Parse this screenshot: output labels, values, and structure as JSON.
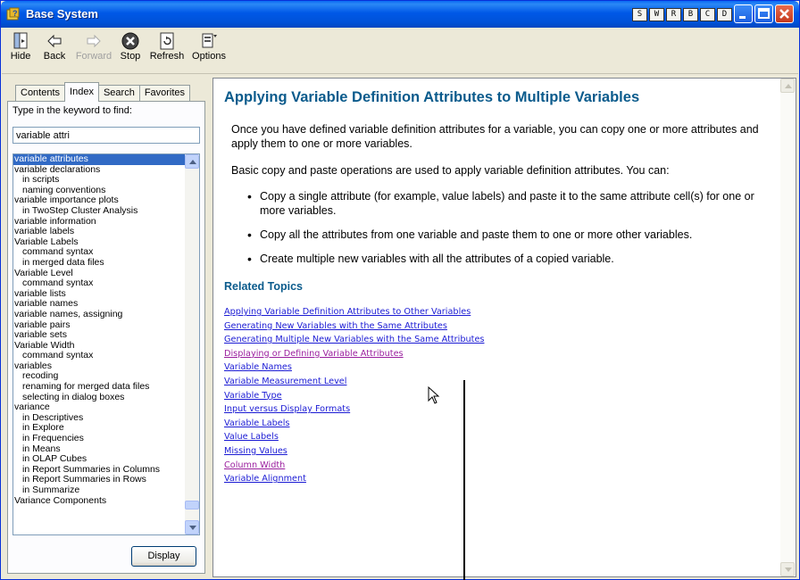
{
  "window": {
    "title": "Base System"
  },
  "title_buttons": [
    "S",
    "W",
    "R",
    "B",
    "C",
    "D"
  ],
  "toolbar": {
    "hide": "Hide",
    "back": "Back",
    "forward": "Forward",
    "stop": "Stop",
    "refresh": "Refresh",
    "options": "Options"
  },
  "tabs": [
    "Contents",
    "Index",
    "Search",
    "Favorites"
  ],
  "index_panel": {
    "label": "Type in the keyword to find:",
    "keyword": "variable attri",
    "display_label": "Display",
    "items": [
      {
        "text": "variable attributes",
        "indent": false,
        "selected": true
      },
      {
        "text": "variable declarations",
        "indent": false
      },
      {
        "text": "in scripts",
        "indent": true
      },
      {
        "text": "naming conventions",
        "indent": true
      },
      {
        "text": "variable importance plots",
        "indent": false
      },
      {
        "text": "in TwoStep Cluster Analysis",
        "indent": true
      },
      {
        "text": "variable information",
        "indent": false
      },
      {
        "text": "variable labels",
        "indent": false
      },
      {
        "text": "Variable Labels",
        "indent": false
      },
      {
        "text": "command syntax",
        "indent": true
      },
      {
        "text": "in merged data files",
        "indent": true
      },
      {
        "text": "Variable Level",
        "indent": false
      },
      {
        "text": "command syntax",
        "indent": true
      },
      {
        "text": "variable lists",
        "indent": false
      },
      {
        "text": "variable names",
        "indent": false
      },
      {
        "text": "variable names, assigning",
        "indent": false
      },
      {
        "text": "variable pairs",
        "indent": false
      },
      {
        "text": "variable sets",
        "indent": false
      },
      {
        "text": "Variable Width",
        "indent": false
      },
      {
        "text": "command syntax",
        "indent": true
      },
      {
        "text": "variables",
        "indent": false
      },
      {
        "text": "recoding",
        "indent": true
      },
      {
        "text": "renaming for merged data files",
        "indent": true
      },
      {
        "text": "selecting in dialog boxes",
        "indent": true
      },
      {
        "text": "variance",
        "indent": false
      },
      {
        "text": "in Descriptives",
        "indent": true
      },
      {
        "text": "in Explore",
        "indent": true
      },
      {
        "text": "in Frequencies",
        "indent": true
      },
      {
        "text": "in Means",
        "indent": true
      },
      {
        "text": "in OLAP Cubes",
        "indent": true
      },
      {
        "text": "in Report Summaries in Columns",
        "indent": true
      },
      {
        "text": "in Report Summaries in Rows",
        "indent": true
      },
      {
        "text": "in Summarize",
        "indent": true
      },
      {
        "text": "Variance Components",
        "indent": false
      }
    ]
  },
  "topic": {
    "title": "Applying Variable Definition Attributes to Multiple Variables",
    "para1": "Once you have defined variable definition attributes for a variable, you can copy one or more attributes and apply them to one or more variables.",
    "para2": "Basic copy and paste operations are used to apply variable definition attributes. You can:",
    "bullets": [
      "Copy a single attribute (for example, value labels) and paste it to the same attribute cell(s) for one or more variables.",
      "Copy all the attributes from one variable and paste them to one or more other variables.",
      "Create multiple new variables with all the attributes of a copied variable."
    ],
    "related_heading": "Related Topics",
    "related_links": [
      {
        "text": "Applying Variable Definition Attributes to Other Variables",
        "visited": false
      },
      {
        "text": "Generating New Variables with the Same Attributes",
        "visited": false
      },
      {
        "text": "Generating Multiple New Variables with the Same Attributes",
        "visited": false
      },
      {
        "text": "Displaying or Defining Variable Attributes",
        "visited": true
      },
      {
        "text": "Variable Names",
        "visited": false
      },
      {
        "text": "Variable Measurement Level",
        "visited": false
      },
      {
        "text": "Variable Type",
        "visited": false
      },
      {
        "text": "Input versus Display Formats",
        "visited": false
      },
      {
        "text": "Variable Labels",
        "visited": false
      },
      {
        "text": "Value Labels",
        "visited": false
      },
      {
        "text": "Missing Values",
        "visited": false
      },
      {
        "text": "Column Width",
        "visited": true
      },
      {
        "text": "Variable Alignment",
        "visited": false
      }
    ]
  },
  "colors": {
    "title_bar": "#0054e3",
    "heading": "#0b5b8c",
    "link": "#1b1bd4",
    "visited_link": "#9a1e9e",
    "selection": "#316ac5"
  }
}
